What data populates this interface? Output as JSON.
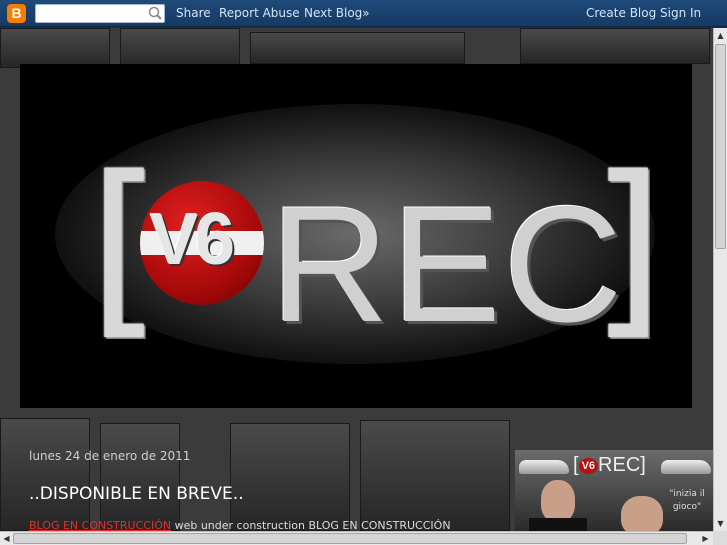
{
  "navbar": {
    "logo_letter": "B",
    "search_value": "",
    "share_label": "Share",
    "report_label": "Report Abuse",
    "next_blog_label": "Next Blog»",
    "create_blog_label": "Create Blog",
    "sign_in_label": "Sign In"
  },
  "banner": {
    "bracket_open": "[",
    "bracket_close": "]",
    "badge_text": "V6",
    "wordmark": "REC"
  },
  "post": {
    "date": "lunes 24 de enero de 2011",
    "title": "..DISPONIBLE EN BREVE..",
    "body_red": "BLOG EN CONSTRUCCIÓN",
    "body_rest": " web under construction BLOG EN CONSTRUCCIÓN"
  },
  "sidebar": {
    "thumb_badge": "V6",
    "thumb_wordmark": "REC",
    "thumb_quote": "\"inizia il gioco\""
  },
  "colors": {
    "navbar": "#1f4a7a",
    "logo_orange": "#f57d00",
    "accent_red": "#e03030"
  }
}
